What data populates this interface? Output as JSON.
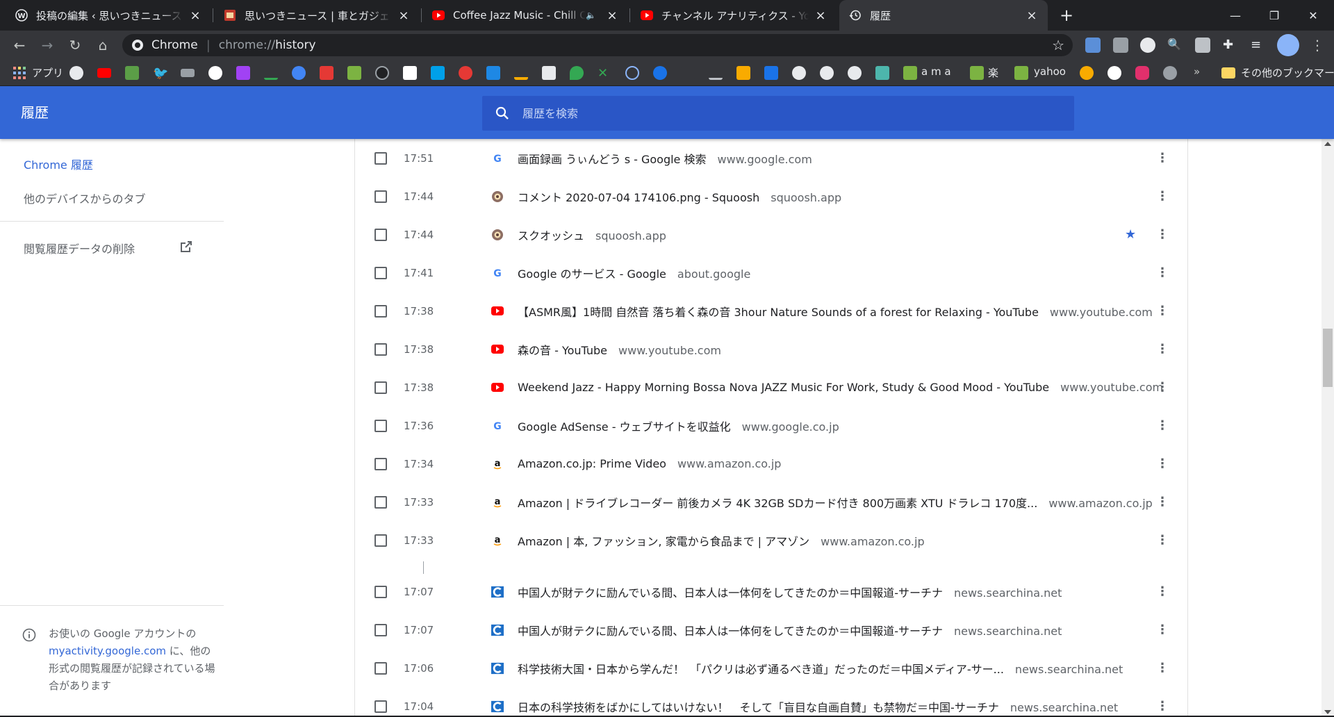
{
  "tabs": [
    {
      "title": "投稿の編集 ‹ 思いつきニュース — WordPress",
      "favicon": "wordpress-icon",
      "active": false
    },
    {
      "title": "思いつきニュース | 車とガジェット、その他",
      "favicon": "site-icon",
      "active": false
    },
    {
      "title": "Coffee Jazz Music - Chill Out",
      "favicon": "youtube-icon",
      "active": false,
      "muted_icon": "🔈"
    },
    {
      "title": "チャンネル アナリティクス - YouTube Studio",
      "favicon": "youtube-icon",
      "active": false
    },
    {
      "title": "履歴",
      "favicon": "history-icon",
      "active": true
    }
  ],
  "omnibox": {
    "label": "Chrome",
    "url_scheme": "chrome://",
    "url_path": "history"
  },
  "bookmarks": {
    "apps_label": "アプリ",
    "text_items": [
      "a m a",
      "楽",
      "yahoo"
    ],
    "more": "»",
    "other_label": "その他のブックマーク"
  },
  "header": {
    "title": "履歴",
    "search_placeholder": "履歴を検索"
  },
  "sidebar": {
    "chrome_history": "Chrome 履歴",
    "other_devices": "他のデバイスからのタブ",
    "clear_data": "閲覧履歴データの削除",
    "note_prefix": "お使いの Google アカウントの",
    "note_link": "myactivity.google.com",
    "note_suffix": " に、他の形式の閲覧履歴が記録されている場合があります"
  },
  "history": [
    {
      "time": "17:51",
      "title": "画面録画 うぃんどう s - Google 検索",
      "domain": "www.google.com",
      "icon": "google-icon",
      "starred": false
    },
    {
      "time": "17:44",
      "title": "コメント 2020-07-04 174106.png - Squoosh",
      "domain": "squoosh.app",
      "icon": "squoosh-icon",
      "starred": false
    },
    {
      "time": "17:44",
      "title": "スクオッシュ",
      "domain": "squoosh.app",
      "icon": "squoosh-icon",
      "starred": true
    },
    {
      "time": "17:41",
      "title": "Google のサービス - Google",
      "domain": "about.google",
      "icon": "google-icon",
      "starred": false
    },
    {
      "time": "17:38",
      "title": "【ASMR風】1時間 自然音 落ち着く森の音 3hour Nature Sounds of a forest for Relaxing - YouTube",
      "domain": "www.youtube.com",
      "icon": "youtube-icon",
      "starred": false
    },
    {
      "time": "17:38",
      "title": "森の音 - YouTube",
      "domain": "www.youtube.com",
      "icon": "youtube-icon",
      "starred": false
    },
    {
      "time": "17:38",
      "title": "Weekend Jazz - Happy Morning Bossa Nova JAZZ Music For Work, Study & Good Mood - YouTube",
      "domain": "www.youtube.com",
      "icon": "youtube-icon",
      "starred": false
    },
    {
      "time": "17:36",
      "title": "Google AdSense - ウェブサイトを収益化",
      "domain": "www.google.co.jp",
      "icon": "google-icon",
      "starred": false
    },
    {
      "time": "17:34",
      "title": "Amazon.co.jp: Prime Video",
      "domain": "www.amazon.co.jp",
      "icon": "amazon-icon",
      "starred": false
    },
    {
      "time": "17:33",
      "title": "Amazon | ドライブレコーダー 前後カメラ 4K 32GB SDカード付き 800万画素 XTU ドラレコ 170度...",
      "domain": "www.amazon.co.jp",
      "icon": "amazon-icon",
      "starred": false
    },
    {
      "time": "17:33",
      "title": "Amazon | 本, ファッション, 家電から食品まで | アマゾン",
      "domain": "www.amazon.co.jp",
      "icon": "amazon-icon",
      "starred": false
    },
    {
      "time": "17:07",
      "title": "中国人が財テクに励んでいる間、日本人は一体何をしてきたのか＝中国報道-サーチナ",
      "domain": "news.searchina.net",
      "icon": "searchina-icon",
      "starred": false
    },
    {
      "time": "17:07",
      "title": "中国人が財テクに励んでいる間、日本人は一体何をしてきたのか＝中国報道-サーチナ",
      "domain": "news.searchina.net",
      "icon": "searchina-icon",
      "starred": false
    },
    {
      "time": "17:06",
      "title": "科学技術大国・日本から学んだ！　「パクリは必ず通るべき道」だったのだ＝中国メディア-サー...",
      "domain": "news.searchina.net",
      "icon": "searchina-icon",
      "starred": false
    },
    {
      "time": "17:04",
      "title": "日本の科学技術をばかにしてはいけない！　そして「盲目な自画自賛」も禁物だ＝中国-サーチナ",
      "domain": "news.searchina.net",
      "icon": "searchina-icon",
      "starred": false
    }
  ],
  "colors": {
    "header_blue": "#3367d6",
    "tabstrip": "#202124",
    "toolbar": "#35363a"
  }
}
